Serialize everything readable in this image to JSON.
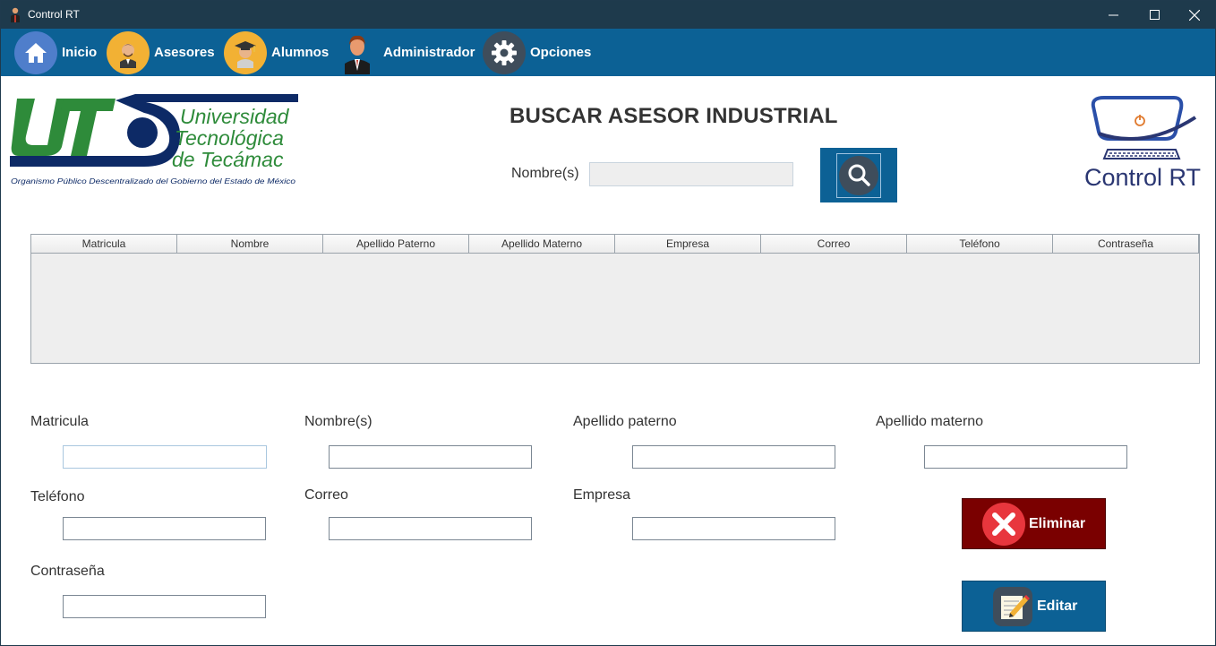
{
  "window": {
    "title": "Control RT"
  },
  "menu": [
    {
      "label": "Inicio",
      "icon": "home-icon"
    },
    {
      "label": "Asesores",
      "icon": "advisor-icon"
    },
    {
      "label": "Alumnos",
      "icon": "graduate-icon"
    },
    {
      "label": "Administrador",
      "icon": "administrator-icon"
    },
    {
      "label": "Opciones",
      "icon": "gear-icon"
    }
  ],
  "logo_ut": {
    "line1": "Universidad",
    "line2": "Tecnológica",
    "line3": "de Tecámac",
    "tagline": "Organismo Público Descentralizado del Gobierno del Estado de México"
  },
  "logo_crt": {
    "text": "Control RT"
  },
  "page": {
    "title": "BUSCAR ASESOR INDUSTRIAL"
  },
  "search": {
    "label": "Nombre(s)",
    "value": ""
  },
  "table": {
    "columns": [
      "Matricula",
      "Nombre",
      "Apellido Paterno",
      "Apellido Materno",
      "Empresa",
      "Correo",
      "Teléfono",
      "Contraseña"
    ],
    "rows": []
  },
  "form": {
    "matricula": {
      "label": "Matricula",
      "value": ""
    },
    "nombre": {
      "label": "Nombre(s)",
      "value": ""
    },
    "apellido_paterno": {
      "label": "Apellido paterno",
      "value": ""
    },
    "apellido_materno": {
      "label": "Apellido materno",
      "value": ""
    },
    "telefono": {
      "label": "Teléfono",
      "value": ""
    },
    "correo": {
      "label": "Correo",
      "value": ""
    },
    "empresa": {
      "label": "Empresa",
      "value": ""
    },
    "contrasena": {
      "label": "Contraseña",
      "value": ""
    }
  },
  "actions": {
    "delete_label": "Eliminar",
    "edit_label": "Editar"
  },
  "colors": {
    "titlebar": "#1e3a4c",
    "menubar": "#0c6195",
    "delete": "#7a0000",
    "edit": "#0c6195",
    "ut_green": "#2e8b3a",
    "ut_navy": "#0d2a66"
  }
}
